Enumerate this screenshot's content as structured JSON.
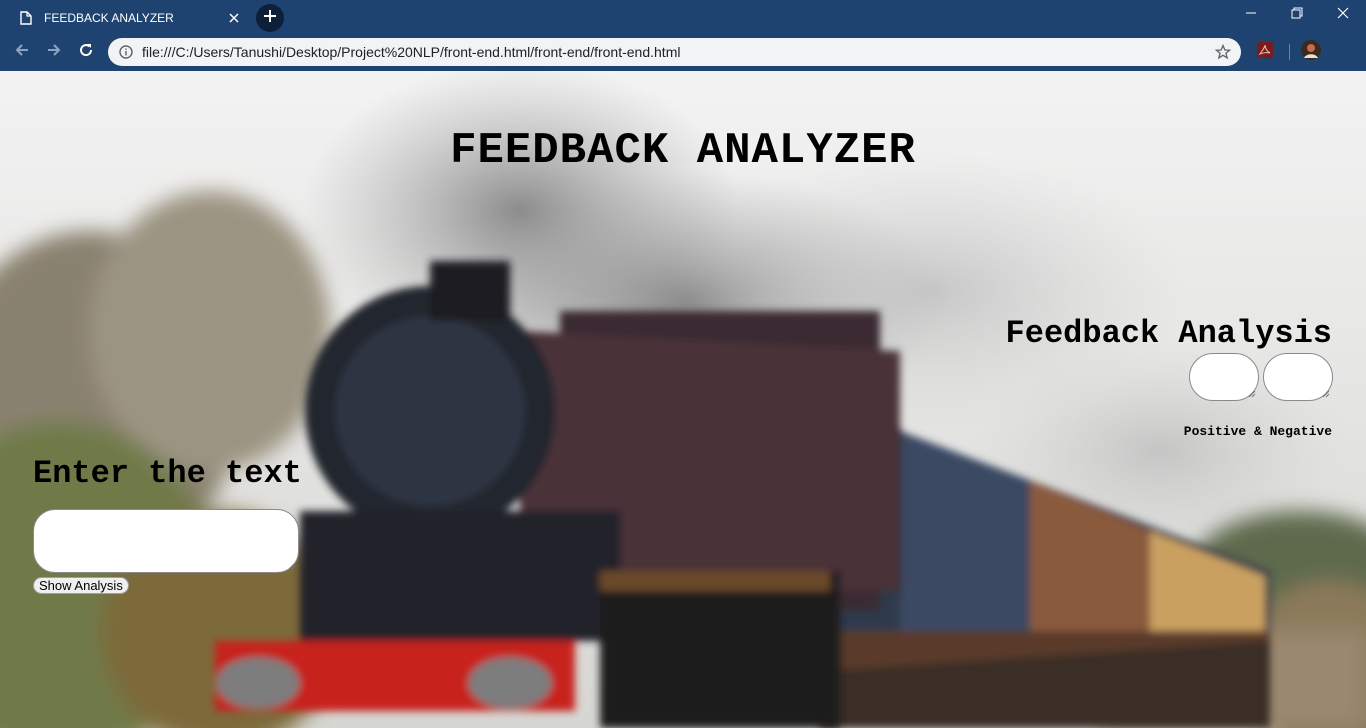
{
  "browser": {
    "tab_title": "FEEDBACK ANALYZER",
    "url": "file:///C:/Users/Tanushi/Desktop/Project%20NLP/front-end.html/front-end/front-end.html",
    "icons": [
      "page-icon",
      "close-icon",
      "plus-icon",
      "minimize-icon",
      "restore-icon",
      "close-window-icon",
      "back-icon",
      "forward-icon",
      "reload-icon",
      "info-icon",
      "star-icon",
      "pdf-extension-icon",
      "profile-avatar"
    ]
  },
  "page": {
    "heading": "FEEDBACK ANALYZER",
    "analysis": {
      "title": "Feedback Analysis",
      "positive_value": "",
      "negative_value": "",
      "caption": "Positive & Negative"
    },
    "input": {
      "label": "Enter the text",
      "value": "",
      "button_label": "Show Analysis"
    }
  },
  "colors": {
    "chrome": "#1f4370",
    "omnibox": "#f1f3f4",
    "text": "#000000"
  }
}
